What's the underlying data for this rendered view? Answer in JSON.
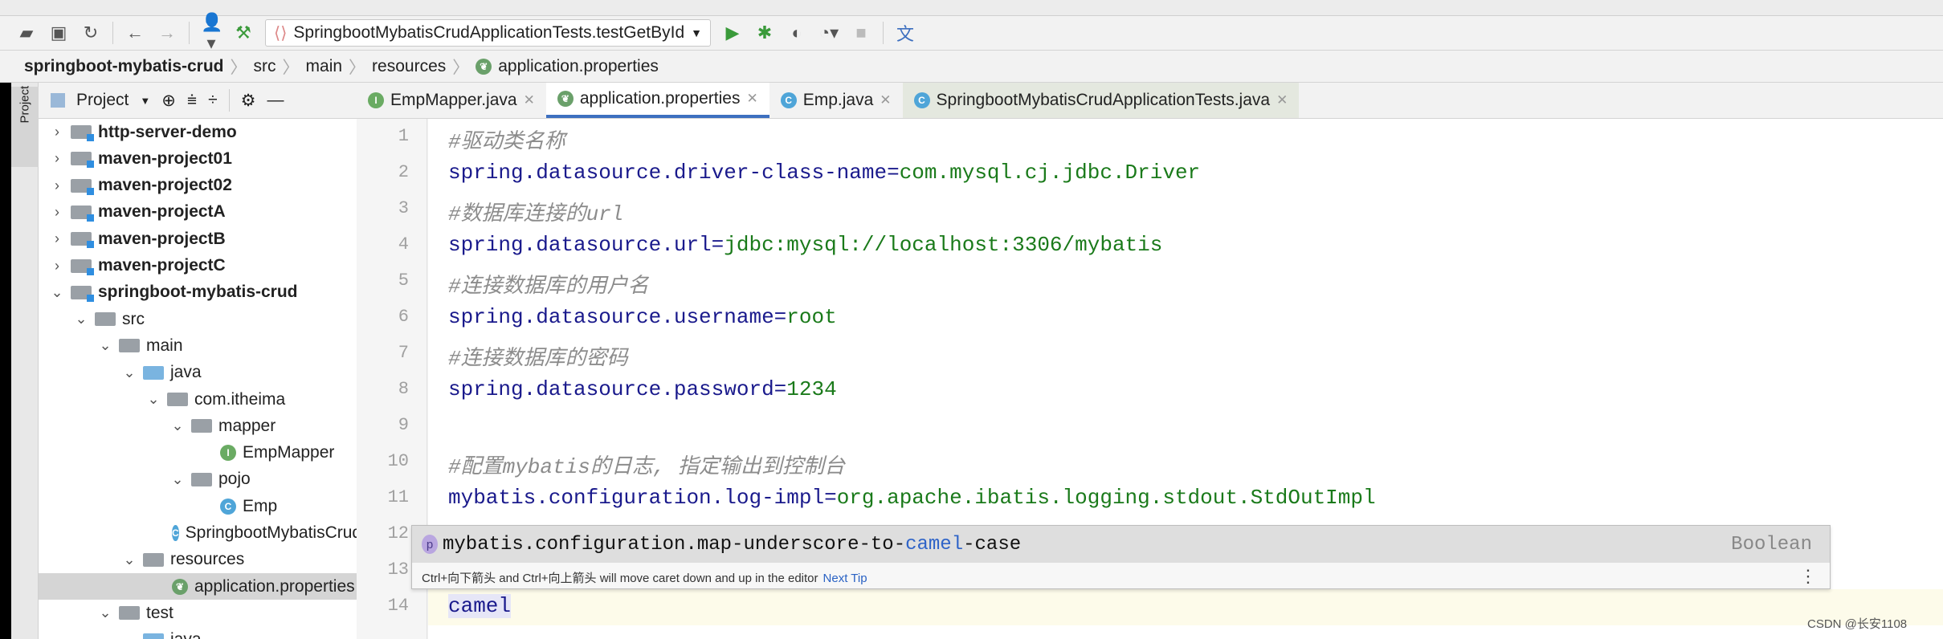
{
  "toolbar": {
    "run_config": "SpringbootMybatisCrudApplicationTests.testGetById"
  },
  "breadcrumb": [
    "springboot-mybatis-crud",
    "src",
    "main",
    "resources",
    "application.properties"
  ],
  "sidebar": {
    "stripe_label": "Project",
    "header_label": "Project"
  },
  "tabs": [
    {
      "label": "EmpMapper.java",
      "icon": "interface-icon"
    },
    {
      "label": "application.properties",
      "icon": "spring-properties-icon",
      "active": true
    },
    {
      "label": "Emp.java",
      "icon": "class-icon"
    },
    {
      "label": "SpringbootMybatisCrudApplicationTests.java",
      "icon": "test-class-icon"
    }
  ],
  "tree": [
    {
      "label": "http-server-demo",
      "bold": true
    },
    {
      "label": "maven-project01",
      "bold": true
    },
    {
      "label": "maven-project02",
      "bold": true
    },
    {
      "label": "maven-projectA",
      "bold": true
    },
    {
      "label": "maven-projectB",
      "bold": true
    },
    {
      "label": "maven-projectC",
      "bold": true
    },
    {
      "label": "springboot-mybatis-crud",
      "bold": true,
      "expanded": true
    },
    {
      "label": "src"
    },
    {
      "label": "main"
    },
    {
      "label": "java"
    },
    {
      "label": "com.itheima"
    },
    {
      "label": "mapper"
    },
    {
      "label": "EmpMapper"
    },
    {
      "label": "pojo"
    },
    {
      "label": "Emp"
    },
    {
      "label": "SpringbootMybatisCrudApplication"
    },
    {
      "label": "resources"
    },
    {
      "label": "application.properties",
      "selected": true
    },
    {
      "label": "test"
    },
    {
      "label": "java"
    }
  ],
  "editor": {
    "lines": [
      {
        "n": "1",
        "comment": "#驱动类名称"
      },
      {
        "n": "2",
        "key": "spring.datasource.driver-class-name=",
        "value": "com.mysql.cj.jdbc.Driver"
      },
      {
        "n": "3",
        "comment": "#数据库连接的url"
      },
      {
        "n": "4",
        "key": "spring.datasource.url=",
        "value": "jdbc:mysql://localhost:3306/mybatis"
      },
      {
        "n": "5",
        "comment": "#连接数据库的用户名"
      },
      {
        "n": "6",
        "key": "spring.datasource.username=",
        "value": "root"
      },
      {
        "n": "7",
        "comment": "#连接数据库的密码"
      },
      {
        "n": "8",
        "key": "spring.datasource.password=",
        "value": "1234"
      },
      {
        "n": "9"
      },
      {
        "n": "10",
        "comment": "#配置mybatis的日志, 指定输出到控制台"
      },
      {
        "n": "11",
        "key": "mybatis.configuration.log-impl=",
        "value": "org.apache.ibatis.logging.stdout.StdOutImpl"
      },
      {
        "n": "12"
      },
      {
        "n": "13"
      },
      {
        "n": "14",
        "key": "camel"
      }
    ]
  },
  "completion": {
    "badge": "p",
    "prefix": "mybatis.configuration.map-underscore-to-",
    "match": "camel",
    "suffix": "-case",
    "type": "Boolean",
    "tip": "Ctrl+向下箭头 and Ctrl+向上箭头 will move caret down and up in the editor",
    "next_tip": "Next Tip"
  },
  "watermark": "CSDN @长安1108"
}
